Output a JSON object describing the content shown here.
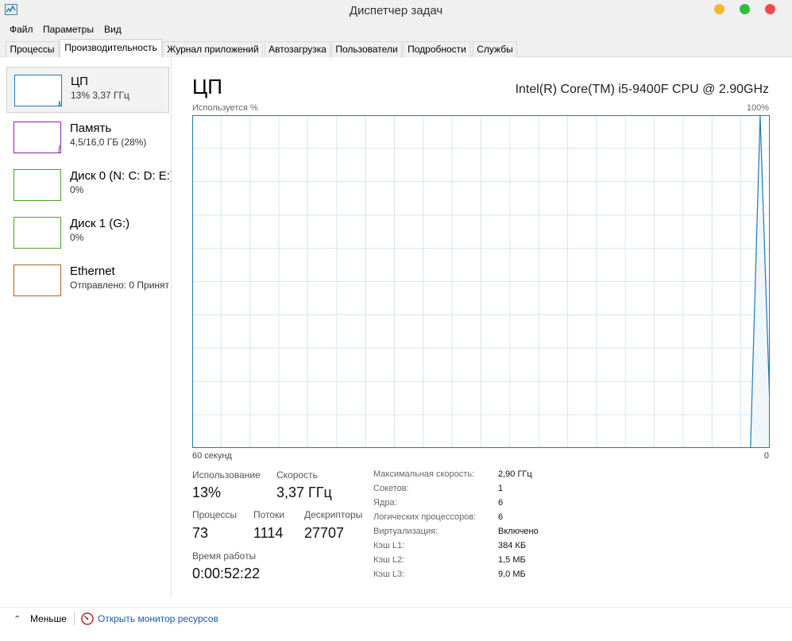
{
  "window": {
    "title": "Диспетчер задач"
  },
  "menu": [
    "Файл",
    "Параметры",
    "Вид"
  ],
  "tabs": [
    {
      "label": "Процессы",
      "active": false
    },
    {
      "label": "Производительность",
      "active": true
    },
    {
      "label": "Журнал приложений",
      "active": false
    },
    {
      "label": "Автозагрузка",
      "active": false
    },
    {
      "label": "Пользователи",
      "active": false
    },
    {
      "label": "Подробности",
      "active": false
    },
    {
      "label": "Службы",
      "active": false
    }
  ],
  "sidebar": {
    "items": [
      {
        "name": "ЦП",
        "detail": "13% 3,37 ГГц",
        "color": "#1d79b8",
        "selected": true
      },
      {
        "name": "Память",
        "detail": "4,5/16,0 ГБ (28%)",
        "color": "#8b22a8",
        "selected": false
      },
      {
        "name": "Диск 0 (N: C: D: E:)",
        "detail": "0%",
        "color": "#4b9f2c",
        "selected": false
      },
      {
        "name": "Диск 1 (G:)",
        "detail": "0%",
        "color": "#4b9f2c",
        "selected": false
      },
      {
        "name": "Ethernet",
        "detail": "Отправлено: 0 Принят",
        "color": "#a8652a",
        "selected": false
      }
    ]
  },
  "main": {
    "title": "ЦП",
    "cpu_model": "Intel(R) Core(TM) i5-9400F CPU @ 2.90GHz",
    "graph": {
      "y_label": "Используется %",
      "y_max_label": "100%",
      "x_left_label": "60 секунд",
      "x_right_label": "0",
      "line_color": "#1d79b8",
      "grid_color": "#d3e7ee",
      "fill_color": "#f1f6fb",
      "series": [
        0,
        0,
        0,
        0,
        0,
        0,
        0,
        0,
        0,
        0,
        0,
        0,
        0,
        0,
        0,
        0,
        0,
        0,
        0,
        0,
        0,
        0,
        0,
        0,
        0,
        0,
        0,
        0,
        0,
        0,
        0,
        0,
        0,
        0,
        0,
        0,
        0,
        0,
        0,
        0,
        0,
        0,
        0,
        0,
        0,
        0,
        0,
        0,
        0,
        0,
        0,
        0,
        0,
        0,
        0,
        0,
        0,
        0,
        0,
        100,
        13
      ]
    },
    "stats": {
      "usage_label": "Использование",
      "usage_value": "13%",
      "speed_label": "Скорость",
      "speed_value": "3,37 ГГц",
      "processes_label": "Процессы",
      "processes_value": "73",
      "threads_label": "Потоки",
      "threads_value": "1114",
      "handles_label": "Дескрипторы",
      "handles_value": "27707",
      "uptime_label": "Время работы",
      "uptime_value": "0:00:52:22"
    },
    "specs": [
      {
        "key": "Максимальная скорость:",
        "value": "2,90 ГГц"
      },
      {
        "key": "Сокетов:",
        "value": "1"
      },
      {
        "key": "Ядра:",
        "value": "6"
      },
      {
        "key": "Логических процессоров:",
        "value": "6"
      },
      {
        "key": "Виртуализация:",
        "value": "Включено"
      },
      {
        "key": "Кэш L1:",
        "value": "384 КБ"
      },
      {
        "key": "Кэш L2:",
        "value": "1,5 МБ"
      },
      {
        "key": "Кэш L3:",
        "value": "9,0 МБ"
      }
    ]
  },
  "footer": {
    "less_label": "Меньше",
    "resource_monitor_link": "Открыть монитор ресурсов"
  }
}
